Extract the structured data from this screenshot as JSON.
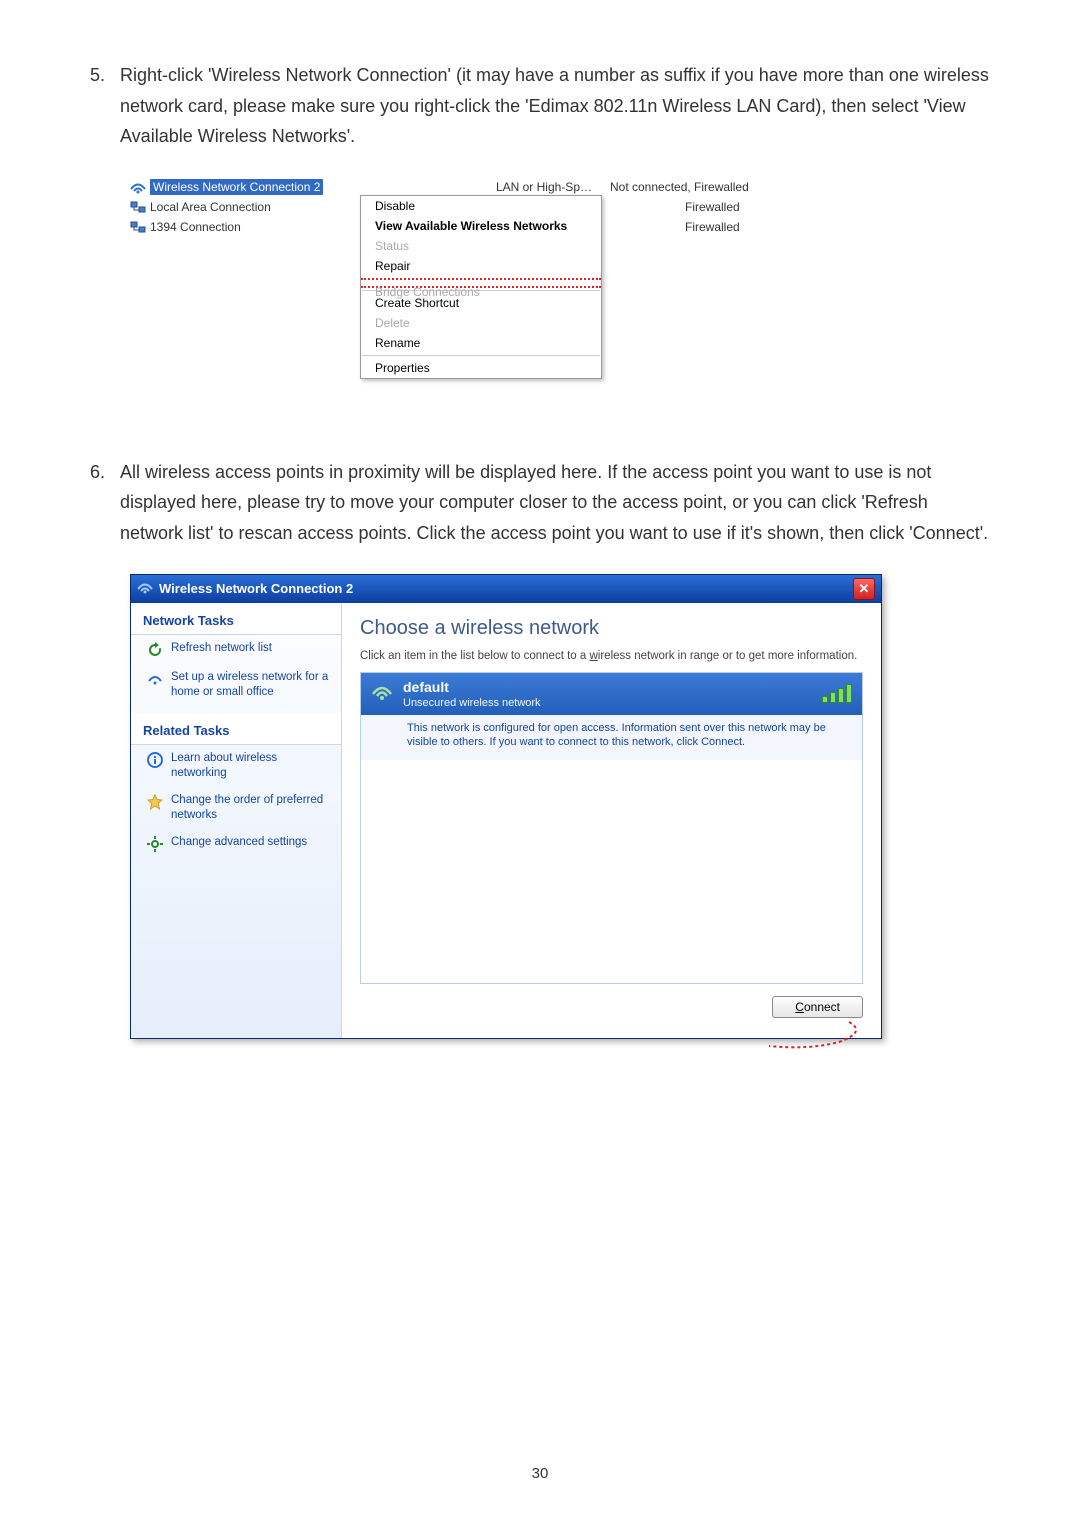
{
  "step5": {
    "num": "5.",
    "text": "Right-click 'Wireless Network Connection' (it may have a number as suffix if you have more than one wireless network card, please make sure you right-click the 'Edimax 802.11n Wireless LAN Card), then select 'View Available Wireless Networks'."
  },
  "fig1": {
    "connections": {
      "wireless": "Wireless Network Connection 2",
      "local": "Local Area Connection",
      "ieee1394": "1394 Connection"
    },
    "status_col": "LAN or High-Sp…",
    "status_val": "Not connected, Firewalled",
    "firewalled": "Firewalled",
    "menu": {
      "disable": "Disable",
      "view": "View Available Wireless Networks",
      "status": "Status",
      "repair": "Repair",
      "bridge": "Bridge Connections",
      "shortcut": "Create Shortcut",
      "delete": "Delete",
      "rename": "Rename",
      "properties": "Properties"
    }
  },
  "step6": {
    "num": "6.",
    "text": "All wireless access points in proximity will be displayed here. If the access point you want to use is not displayed here, please try to move your computer closer to the access point, or you can click 'Refresh network list' to rescan access points. Click the access point you want to use if it's shown, then click 'Connect'."
  },
  "fig2": {
    "title": "Wireless Network Connection 2",
    "sidebar": {
      "section1": "Network Tasks",
      "refresh": "Refresh network list",
      "setup": "Set up a wireless network for a home or small office",
      "section2": "Related Tasks",
      "learn": "Learn about wireless networking",
      "order": "Change the order of preferred networks",
      "advanced": "Change advanced settings"
    },
    "main": {
      "heading": "Choose a wireless network",
      "sub_pre": "Click an item in the list below to connect to a ",
      "sub_ul": "w",
      "sub_post": "ireless network in range or to get more information.",
      "ssid": "default",
      "unsecured": "Unsecured wireless network",
      "desc": "This network is configured for open access. Information sent over this network may be visible to others. If you want to connect to this network, click Connect.",
      "connect_pre": "C",
      "connect_post": "onnect"
    }
  },
  "page_num": "30"
}
